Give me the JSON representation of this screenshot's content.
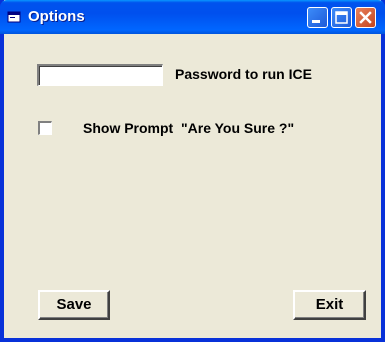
{
  "window": {
    "title": "Options",
    "icons": {
      "app": "app-window-icon",
      "minimize": "minimize-icon",
      "maximize": "maximize-icon",
      "close": "close-icon"
    }
  },
  "password": {
    "value": "",
    "label": "Password to run ICE"
  },
  "prompt": {
    "checked": false,
    "label": "Show Prompt  \"Are You Sure ?\""
  },
  "buttons": {
    "save": "Save",
    "exit": "Exit"
  },
  "colors": {
    "titlebar": "#0050ee",
    "window_bg": "#ece9d8",
    "close_button": "#c44520"
  }
}
